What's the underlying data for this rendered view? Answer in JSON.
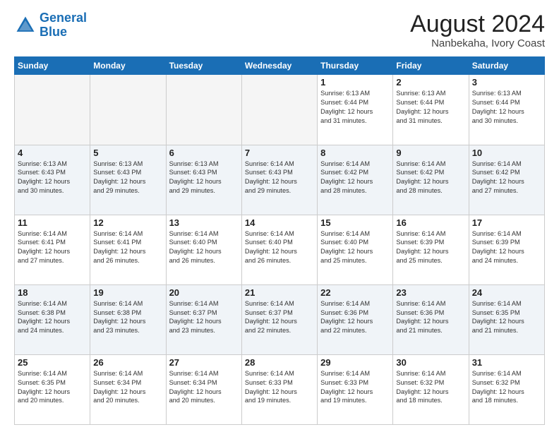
{
  "header": {
    "logo_line1": "General",
    "logo_line2": "Blue",
    "main_title": "August 2024",
    "subtitle": "Nanbekaha, Ivory Coast"
  },
  "days_of_week": [
    "Sunday",
    "Monday",
    "Tuesday",
    "Wednesday",
    "Thursday",
    "Friday",
    "Saturday"
  ],
  "weeks": [
    {
      "shaded": false,
      "days": [
        {
          "num": "",
          "info": ""
        },
        {
          "num": "",
          "info": ""
        },
        {
          "num": "",
          "info": ""
        },
        {
          "num": "",
          "info": ""
        },
        {
          "num": "1",
          "info": "Sunrise: 6:13 AM\nSunset: 6:44 PM\nDaylight: 12 hours\nand 31 minutes."
        },
        {
          "num": "2",
          "info": "Sunrise: 6:13 AM\nSunset: 6:44 PM\nDaylight: 12 hours\nand 31 minutes."
        },
        {
          "num": "3",
          "info": "Sunrise: 6:13 AM\nSunset: 6:44 PM\nDaylight: 12 hours\nand 30 minutes."
        }
      ]
    },
    {
      "shaded": true,
      "days": [
        {
          "num": "4",
          "info": "Sunrise: 6:13 AM\nSunset: 6:43 PM\nDaylight: 12 hours\nand 30 minutes."
        },
        {
          "num": "5",
          "info": "Sunrise: 6:13 AM\nSunset: 6:43 PM\nDaylight: 12 hours\nand 29 minutes."
        },
        {
          "num": "6",
          "info": "Sunrise: 6:13 AM\nSunset: 6:43 PM\nDaylight: 12 hours\nand 29 minutes."
        },
        {
          "num": "7",
          "info": "Sunrise: 6:14 AM\nSunset: 6:43 PM\nDaylight: 12 hours\nand 29 minutes."
        },
        {
          "num": "8",
          "info": "Sunrise: 6:14 AM\nSunset: 6:42 PM\nDaylight: 12 hours\nand 28 minutes."
        },
        {
          "num": "9",
          "info": "Sunrise: 6:14 AM\nSunset: 6:42 PM\nDaylight: 12 hours\nand 28 minutes."
        },
        {
          "num": "10",
          "info": "Sunrise: 6:14 AM\nSunset: 6:42 PM\nDaylight: 12 hours\nand 27 minutes."
        }
      ]
    },
    {
      "shaded": false,
      "days": [
        {
          "num": "11",
          "info": "Sunrise: 6:14 AM\nSunset: 6:41 PM\nDaylight: 12 hours\nand 27 minutes."
        },
        {
          "num": "12",
          "info": "Sunrise: 6:14 AM\nSunset: 6:41 PM\nDaylight: 12 hours\nand 26 minutes."
        },
        {
          "num": "13",
          "info": "Sunrise: 6:14 AM\nSunset: 6:40 PM\nDaylight: 12 hours\nand 26 minutes."
        },
        {
          "num": "14",
          "info": "Sunrise: 6:14 AM\nSunset: 6:40 PM\nDaylight: 12 hours\nand 26 minutes."
        },
        {
          "num": "15",
          "info": "Sunrise: 6:14 AM\nSunset: 6:40 PM\nDaylight: 12 hours\nand 25 minutes."
        },
        {
          "num": "16",
          "info": "Sunrise: 6:14 AM\nSunset: 6:39 PM\nDaylight: 12 hours\nand 25 minutes."
        },
        {
          "num": "17",
          "info": "Sunrise: 6:14 AM\nSunset: 6:39 PM\nDaylight: 12 hours\nand 24 minutes."
        }
      ]
    },
    {
      "shaded": true,
      "days": [
        {
          "num": "18",
          "info": "Sunrise: 6:14 AM\nSunset: 6:38 PM\nDaylight: 12 hours\nand 24 minutes."
        },
        {
          "num": "19",
          "info": "Sunrise: 6:14 AM\nSunset: 6:38 PM\nDaylight: 12 hours\nand 23 minutes."
        },
        {
          "num": "20",
          "info": "Sunrise: 6:14 AM\nSunset: 6:37 PM\nDaylight: 12 hours\nand 23 minutes."
        },
        {
          "num": "21",
          "info": "Sunrise: 6:14 AM\nSunset: 6:37 PM\nDaylight: 12 hours\nand 22 minutes."
        },
        {
          "num": "22",
          "info": "Sunrise: 6:14 AM\nSunset: 6:36 PM\nDaylight: 12 hours\nand 22 minutes."
        },
        {
          "num": "23",
          "info": "Sunrise: 6:14 AM\nSunset: 6:36 PM\nDaylight: 12 hours\nand 21 minutes."
        },
        {
          "num": "24",
          "info": "Sunrise: 6:14 AM\nSunset: 6:35 PM\nDaylight: 12 hours\nand 21 minutes."
        }
      ]
    },
    {
      "shaded": false,
      "days": [
        {
          "num": "25",
          "info": "Sunrise: 6:14 AM\nSunset: 6:35 PM\nDaylight: 12 hours\nand 20 minutes."
        },
        {
          "num": "26",
          "info": "Sunrise: 6:14 AM\nSunset: 6:34 PM\nDaylight: 12 hours\nand 20 minutes."
        },
        {
          "num": "27",
          "info": "Sunrise: 6:14 AM\nSunset: 6:34 PM\nDaylight: 12 hours\nand 20 minutes."
        },
        {
          "num": "28",
          "info": "Sunrise: 6:14 AM\nSunset: 6:33 PM\nDaylight: 12 hours\nand 19 minutes."
        },
        {
          "num": "29",
          "info": "Sunrise: 6:14 AM\nSunset: 6:33 PM\nDaylight: 12 hours\nand 19 minutes."
        },
        {
          "num": "30",
          "info": "Sunrise: 6:14 AM\nSunset: 6:32 PM\nDaylight: 12 hours\nand 18 minutes."
        },
        {
          "num": "31",
          "info": "Sunrise: 6:14 AM\nSunset: 6:32 PM\nDaylight: 12 hours\nand 18 minutes."
        }
      ]
    }
  ]
}
